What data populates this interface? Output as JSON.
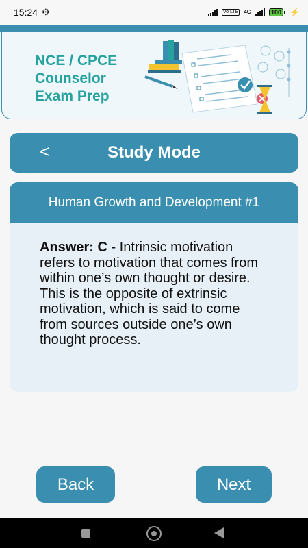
{
  "status_bar": {
    "time": "15:24",
    "network": "4G",
    "volte": "Vo LTE",
    "battery": "100"
  },
  "banner": {
    "title_lines": [
      "NCE / CPCE",
      "Counselor",
      "Exam Prep"
    ],
    "illustration": "exam-paper-books-hourglass-illustration"
  },
  "header": {
    "back_glyph": "<",
    "title": "Study Mode"
  },
  "card": {
    "title": "Human Growth and Development #1",
    "answer_label": "Answer: C",
    "answer_text": " - Intrinsic motivation refers to motivation that comes from within one’s own thought or desire. This is the opposite of extrinsic motivation, which is said to come from sources outside one’s own thought process."
  },
  "buttons": {
    "back": "Back",
    "next": "Next"
  },
  "colors": {
    "primary": "#3a8eb0",
    "banner_text": "#26a2a0",
    "card_bg": "#e6f0f6"
  }
}
